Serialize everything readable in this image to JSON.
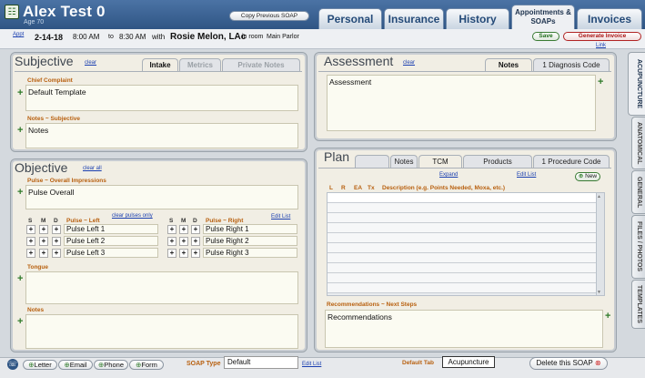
{
  "header": {
    "patient_name": "Alex Test 0",
    "patient_age": "Age 70",
    "copy_button": "Copy Previous SOAP",
    "tabs": [
      {
        "label": "Personal"
      },
      {
        "label": "Insurance"
      },
      {
        "label": "History"
      },
      {
        "label": "Appointments & SOAPs"
      },
      {
        "label": "Invoices"
      }
    ]
  },
  "appointment": {
    "appt_link": "Appt",
    "date": "2-14-18",
    "start": "8:00 AM",
    "to": "to",
    "end": "8:30 AM",
    "with": "with",
    "provider": "Rosie Melon, LAc",
    "in_room": "in room",
    "room": "Main Parlor",
    "save": "Save",
    "generate_invoice": "Generate Invoice",
    "link": "Link"
  },
  "subjective": {
    "title": "Subjective",
    "clear": "clear",
    "tabs": [
      "Intake",
      "Metrics",
      "Private Notes"
    ],
    "chief_complaint_label": "Chief Complaint",
    "chief_complaint": "Default Template",
    "notes_label": "Notes ~ Subjective",
    "notes": "Notes"
  },
  "objective": {
    "title": "Objective",
    "clear_all": "clear all",
    "overall_label": "Pulse ~ Overall Impressions",
    "overall": "Pulse Overall",
    "smd": [
      "S",
      "M",
      "D"
    ],
    "pulse_left_label": "Pulse ~ Left",
    "clear_pulses": "clear pulses only",
    "pulse_right_label": "Pulse ~ Right",
    "edit_list": "Edit List",
    "pulses_left": [
      "Pulse Left 1",
      "Pulse Left 2",
      "Pulse Left 3"
    ],
    "pulses_right": [
      "Pulse Right 1",
      "Pulse Right 2",
      "Pulse Right 3"
    ],
    "tongue_label": "Tongue",
    "notes_label": "Notes"
  },
  "assessment": {
    "title": "Assessment",
    "clear": "clear",
    "tabs": [
      "Notes",
      "1 Diagnosis Code"
    ],
    "text": "Assessment"
  },
  "plan": {
    "title": "Plan",
    "tabs": [
      "Notes",
      "TCM",
      "Products",
      "1 Procedure Code"
    ],
    "expand": "Expand",
    "edit_list": "Edit List",
    "new_button": "New",
    "columns": [
      "L",
      "R",
      "EA",
      "Tx",
      "Description (e.g. Points Needed, Moxa, etc.)"
    ],
    "recommendations_label": "Recommendations ~ Next Steps",
    "recommendations": "Recommendations"
  },
  "side_tabs": [
    "ACUPUNCTURE",
    "ANATOMICAL",
    "GENERAL",
    "FILES / PHOTOS",
    "TEMPLATES"
  ],
  "footer": {
    "letter": "Letter",
    "email": "Email",
    "phone": "Phone",
    "form": "Form",
    "soap_type_label": "SOAP Type",
    "soap_type": "Default",
    "edit_list": "Edit List",
    "default_tab_label": "Default Tab",
    "default_tab": "Acupuncture",
    "delete": "Delete this SOAP"
  }
}
